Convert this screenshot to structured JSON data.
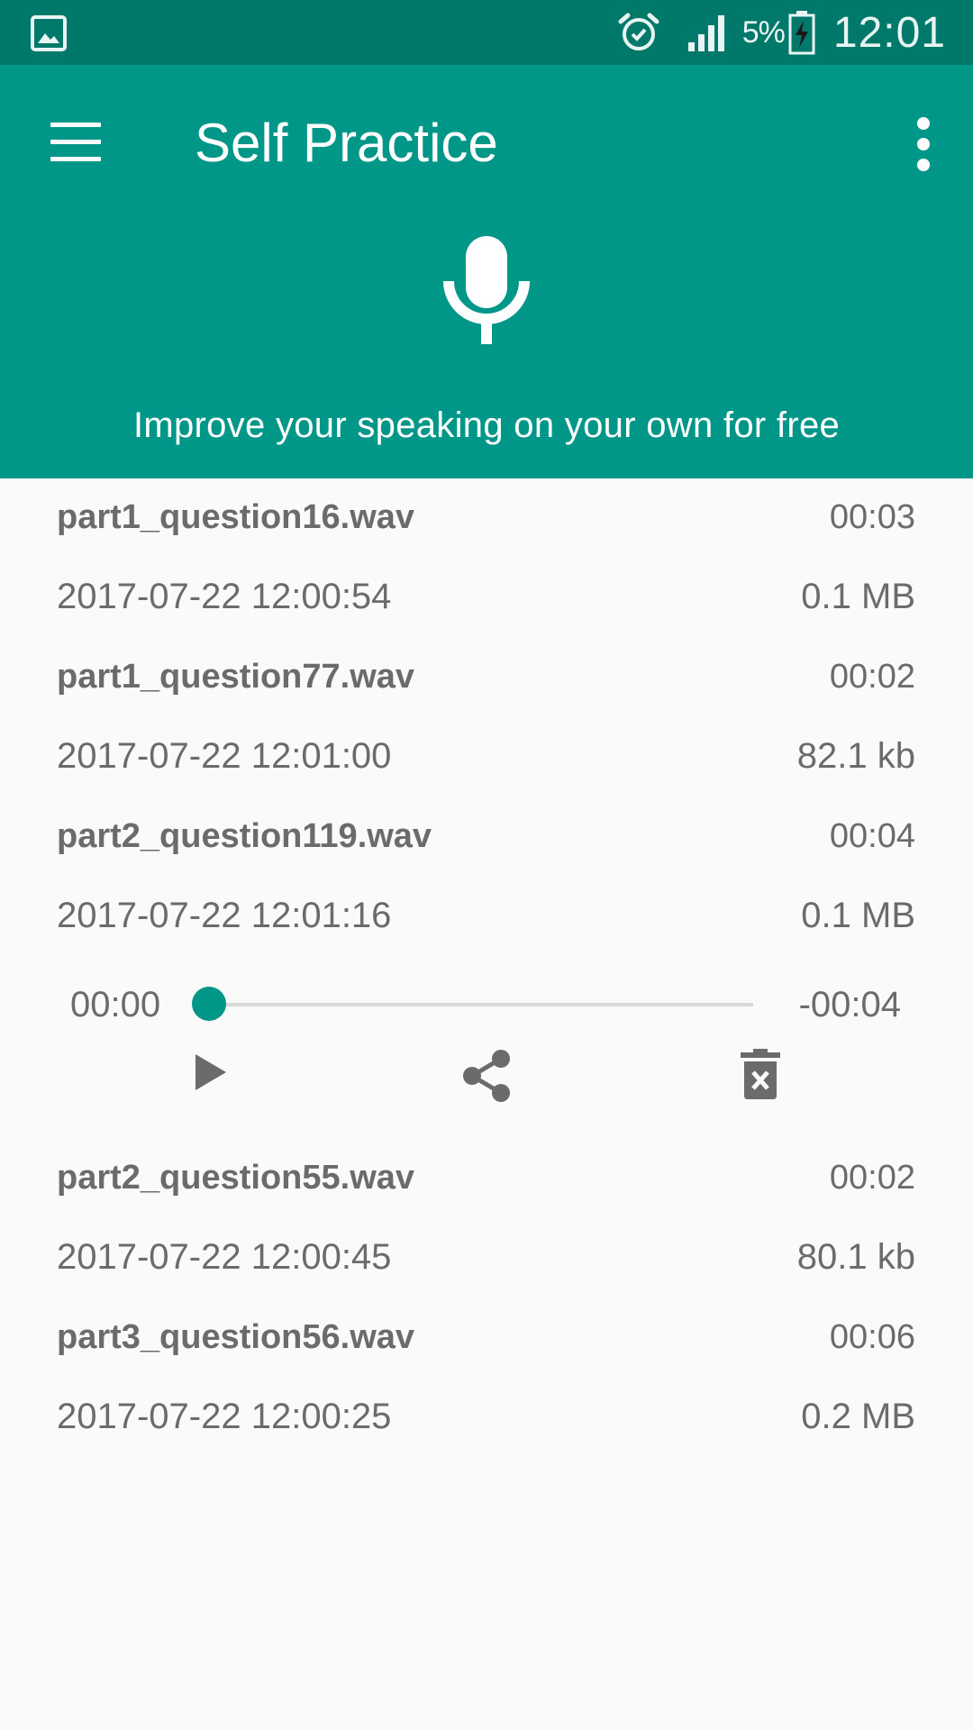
{
  "status_bar": {
    "battery_percent": "5%",
    "time": "12:01",
    "icons": [
      "gallery-icon",
      "alarm-icon",
      "signal-icon",
      "battery-charging-icon"
    ]
  },
  "app_bar": {
    "title": "Self Practice",
    "subtitle": "Improve your speaking on your own for free",
    "icons": [
      "menu-icon",
      "microphone-icon",
      "more-vert-icon"
    ]
  },
  "recordings": [
    {
      "name": "part1_question16.wav",
      "duration": "00:03",
      "date": "2017-07-22 12:00:54",
      "size": "0.1 MB"
    },
    {
      "name": "part1_question77.wav",
      "duration": "00:02",
      "date": "2017-07-22 12:01:00",
      "size": "82.1 kb"
    },
    {
      "name": "part2_question119.wav",
      "duration": "00:04",
      "date": "2017-07-22 12:01:16",
      "size": "0.1 MB"
    },
    {
      "name": "part2_question55.wav",
      "duration": "00:02",
      "date": "2017-07-22 12:00:45",
      "size": "80.1 kb"
    },
    {
      "name": "part3_question56.wav",
      "duration": "00:06",
      "date": "2017-07-22 12:00:25",
      "size": "0.2 MB"
    }
  ],
  "player": {
    "current_time": "00:00",
    "remaining_time": "-00:04",
    "progress": 0.0,
    "icons": [
      "play-icon",
      "share-icon",
      "delete-icon"
    ]
  },
  "colors": {
    "status_bar": "#00796b",
    "primary": "#009688",
    "text": "#6b6b6b",
    "background": "#fafafa"
  }
}
